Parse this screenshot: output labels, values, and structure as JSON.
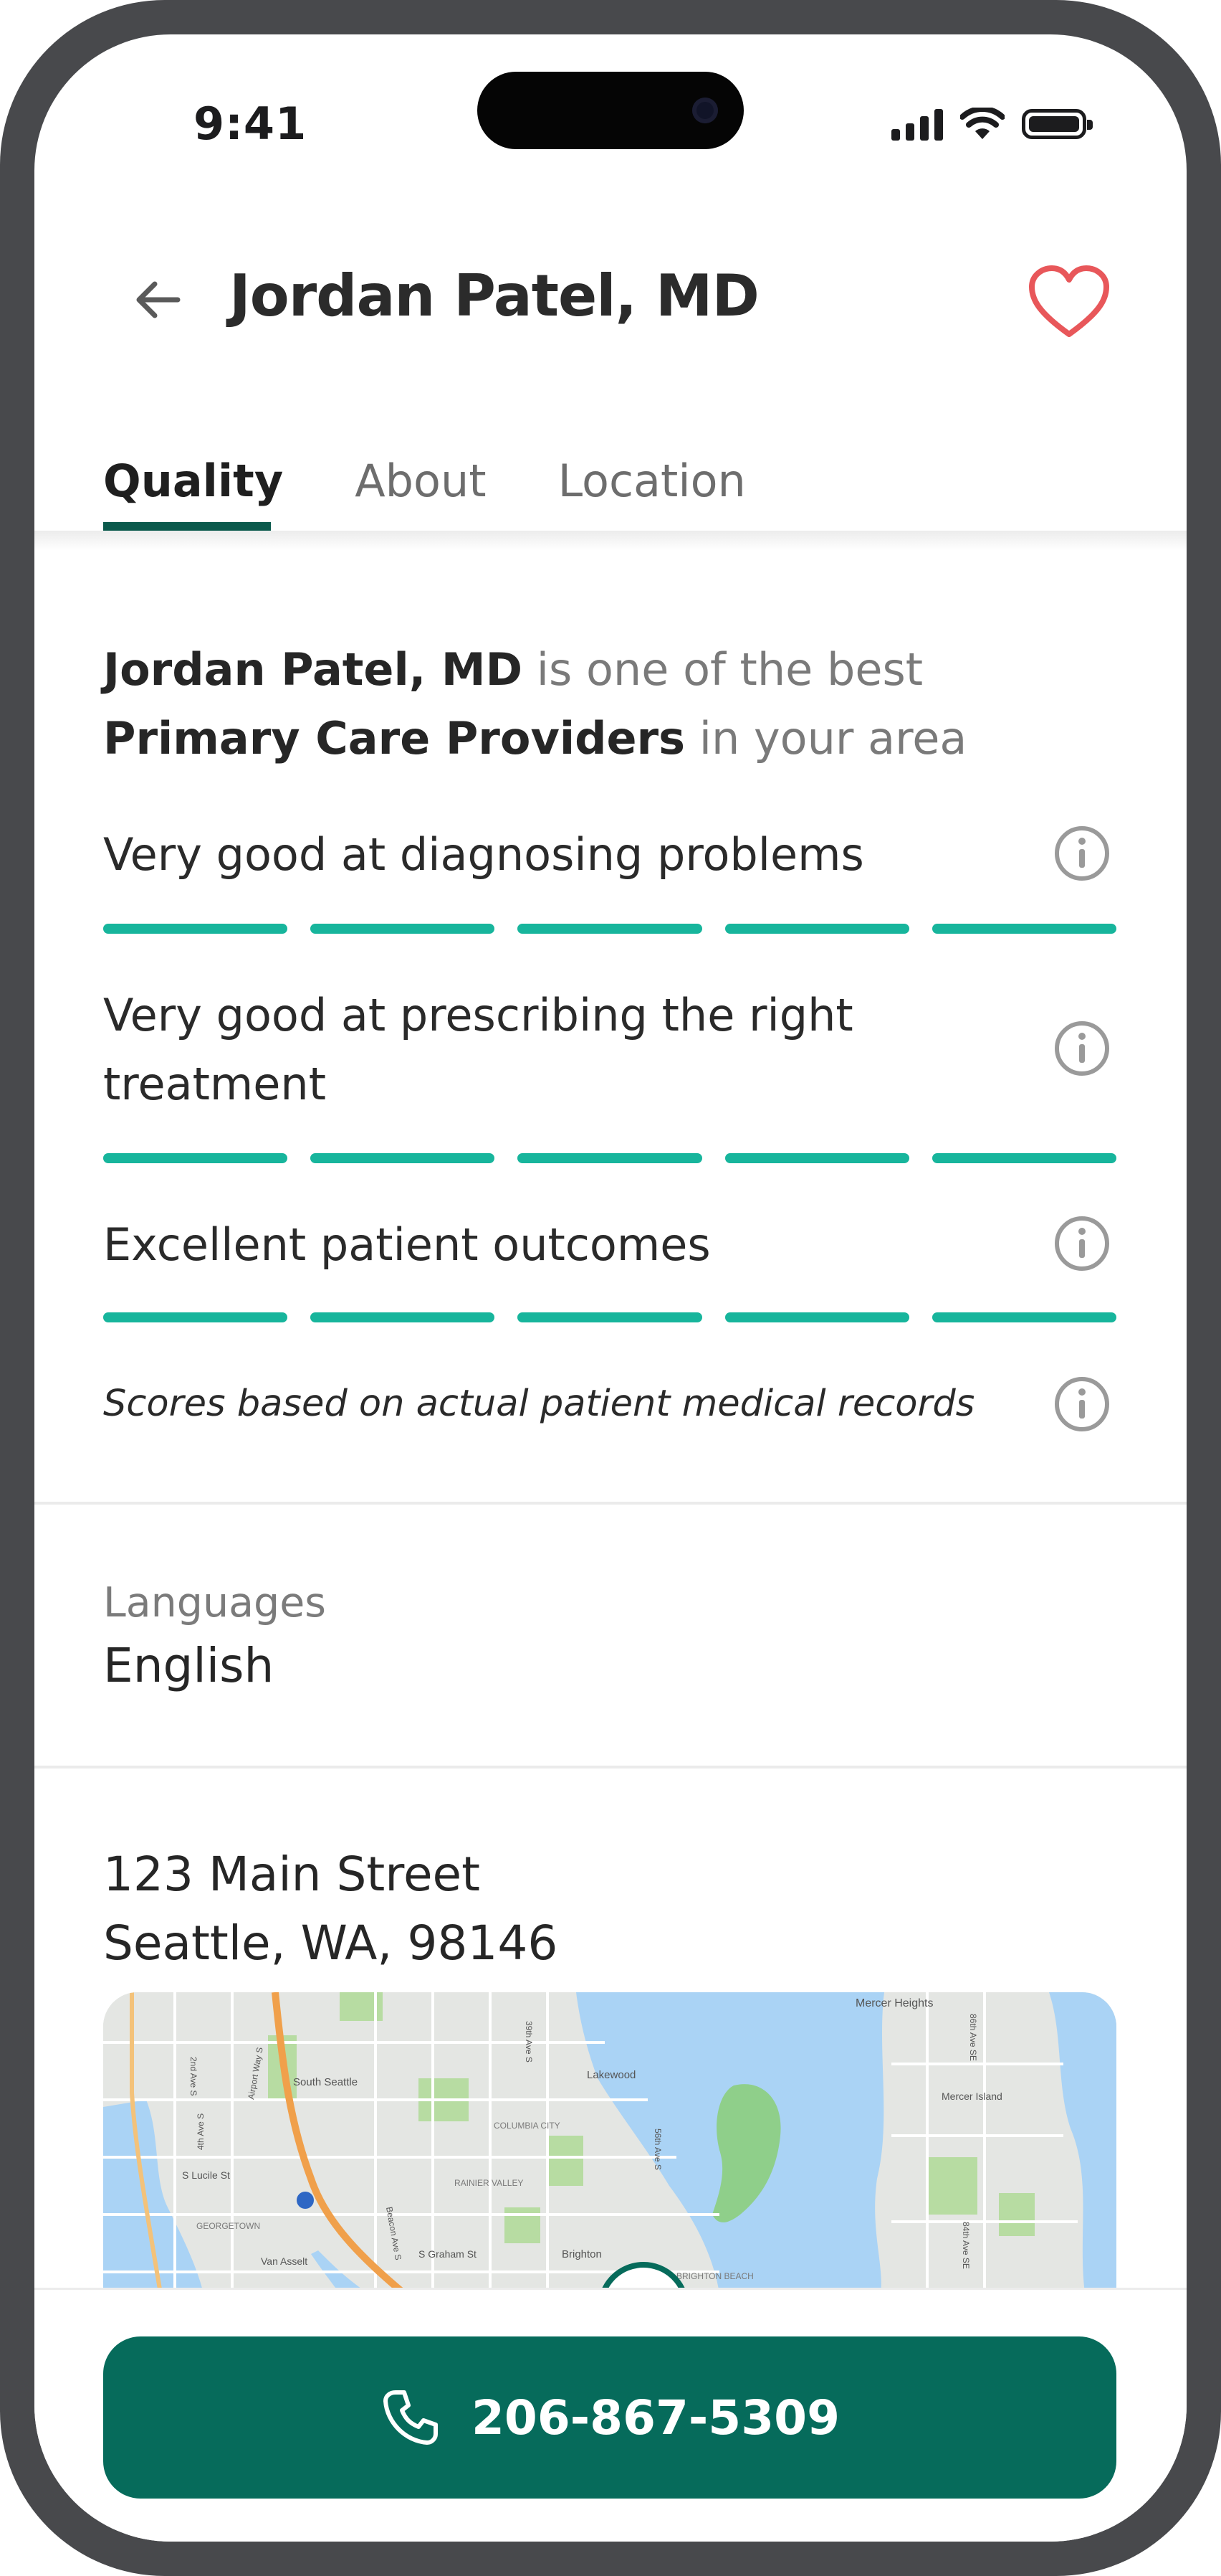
{
  "status": {
    "time": "9:41"
  },
  "header": {
    "title": "Jordan Patel, MD"
  },
  "tabs": [
    {
      "label": "Quality",
      "active": true
    },
    {
      "label": "About",
      "active": false
    },
    {
      "label": "Location",
      "active": false
    }
  ],
  "quality": {
    "intro": {
      "name": "Jordan Patel, MD",
      "text1": " is one of the best ",
      "specialty": "Primary Care Providers",
      "text2": " in your area"
    },
    "metrics": [
      {
        "label": "Very good at diagnosing problems",
        "score": 5,
        "max": 5
      },
      {
        "label": "Very good at prescribing the right treatment",
        "score": 5,
        "max": 5
      },
      {
        "label": "Excellent patient outcomes",
        "score": 5,
        "max": 5
      }
    ],
    "footnote": "Scores based on actual patient medical records"
  },
  "languages": {
    "label": "Languages",
    "value": "English"
  },
  "location": {
    "line1": "123 Main Street",
    "line2": "Seattle, WA, 98146"
  },
  "map_labels": {
    "mercer_heights": "Mercer Heights",
    "mercer_island": "Mercer Island",
    "south_seattle": "South Seattle",
    "lakewood": "Lakewood",
    "columbia_city": "COLUMBIA CITY",
    "rainier_valley": "RAINIER VALLEY",
    "s_lucile_st": "S Lucile St",
    "georgetown": "GEORGETOWN",
    "s_graham_st": "S Graham St",
    "brighton": "Brighton",
    "brighton_beach": "BRIGHTON BEACH",
    "van_asselt": "Van Asselt",
    "airport_way": "Airport Way S",
    "beacon_ave": "Beacon Ave S",
    "ave_4th": "4th Ave S",
    "ave_2nd": "2nd Ave S",
    "ave_39th": "39th Ave S",
    "ave_56th": "56th Ave S",
    "ave_84th": "84th Ave SE",
    "ave_86th": "86th Ave SE"
  },
  "colors": {
    "primary": "#066b5b",
    "score_bar": "#17b59c",
    "heart": "#e8575a",
    "map_water": "#aad3f5",
    "map_park": "#b7dca2"
  },
  "cta": {
    "phone": "206-867-5309"
  }
}
